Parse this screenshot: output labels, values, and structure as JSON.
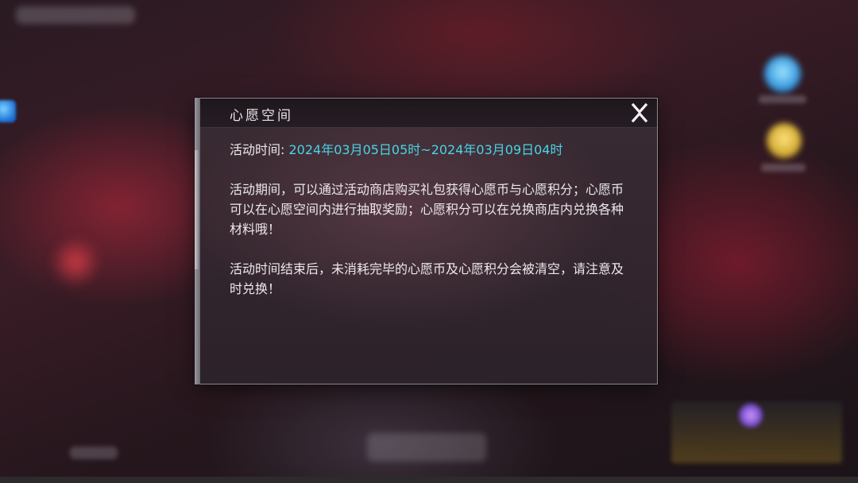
{
  "dialog": {
    "title": "心愿空间",
    "close_label": "X",
    "time_label": "活动时间: ",
    "time_value": "2024年03月05日05时~2024年03月09日04时",
    "paragraphs": [
      "活动期间，可以通过活动商店购买礼包获得心愿币与心愿积分；心愿币可以在心愿空间内进行抽取奖励；心愿积分可以在兑换商店内兑换各种材料哦！",
      "活动时间结束后，未消耗完毕的心愿币及心愿积分会被清空，请注意及时兑换！"
    ]
  },
  "colors": {
    "accent_cyan": "#49d4e6",
    "text": "#ece8ec",
    "dialog_border": "#8d8a91"
  }
}
